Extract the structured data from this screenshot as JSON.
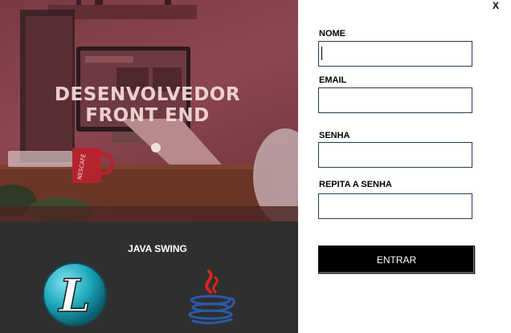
{
  "hero": {
    "title_line1": "DESENVOLVEDOR",
    "title_line2": "FRONT END",
    "mug_brand": "NESCAFÉ"
  },
  "band": {
    "caption": "JAVA SWING",
    "logos": [
      "letter-l-logo-icon",
      "java-logo-icon"
    ]
  },
  "window": {
    "close_label": "X"
  },
  "form": {
    "nome_label": "NOME",
    "nome_value": "",
    "email_label": "EMAIL",
    "email_value": "",
    "senha_label": "SENHA",
    "senha_value": "",
    "repita_label": "REPITA A SENHA",
    "repita_value": "",
    "submit_label": "ENTRAR"
  },
  "colors": {
    "hero_tint": "#8d4750",
    "band_background": "#2f2f2f",
    "input_border": "#2b3a55",
    "button_background": "#000000",
    "logo_l_teal": "#1aa3b8",
    "java_blue": "#2a5aa8",
    "java_red": "#d8261c"
  }
}
